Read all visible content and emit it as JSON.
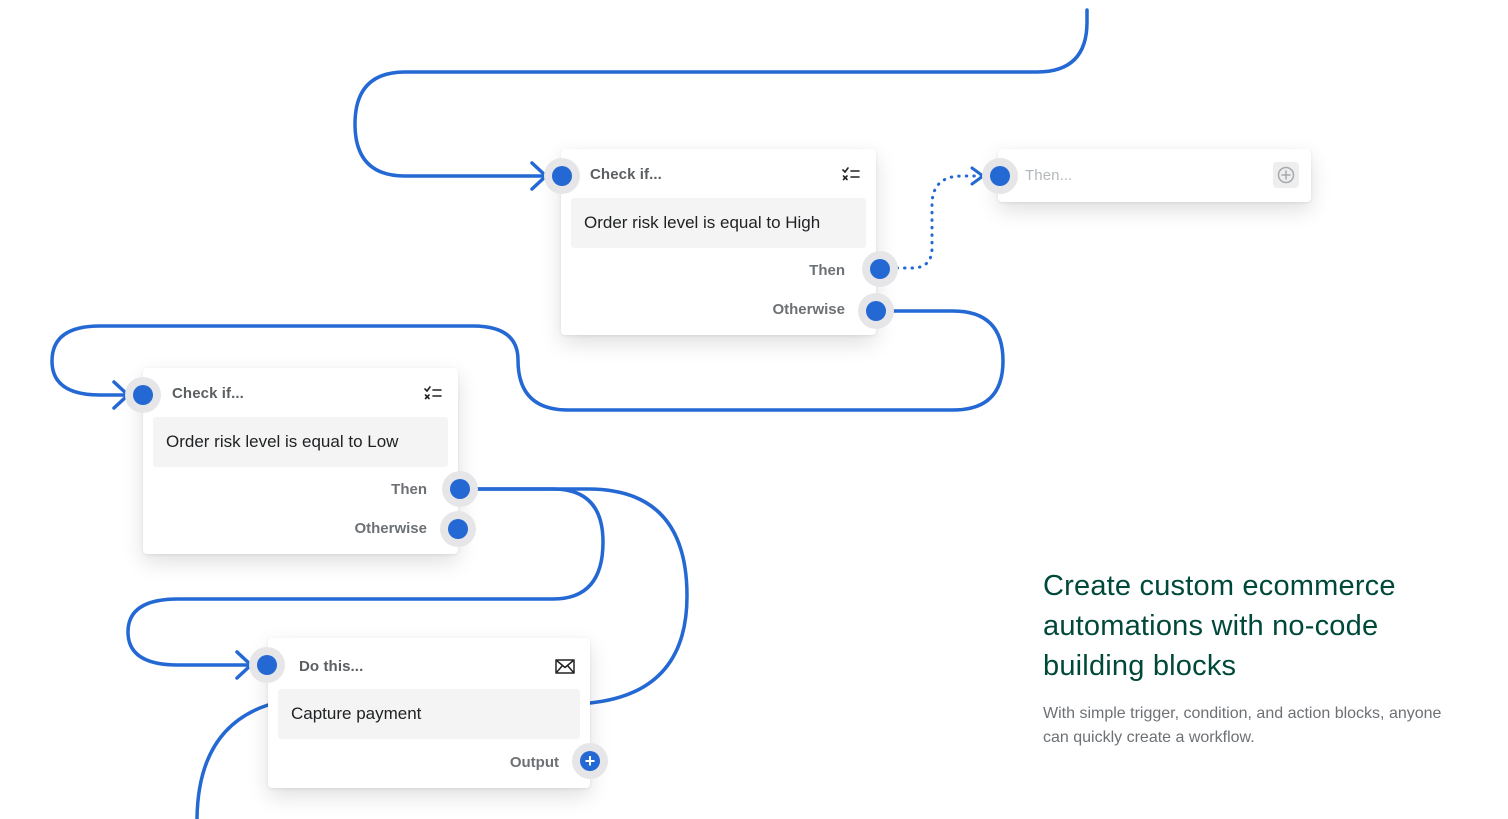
{
  "colors": {
    "connector": "#2468d4",
    "heading_green": "#00493a",
    "muted_text": "#6d7175"
  },
  "blocks": {
    "condition_high": {
      "header": "Check if...",
      "icon": "checklist-icon",
      "body": "Order risk level is equal to High",
      "then_label": "Then",
      "otherwise_label": "Otherwise"
    },
    "then_placeholder": {
      "header": "Then...",
      "icon": "add-circle-icon"
    },
    "condition_low": {
      "header": "Check if...",
      "icon": "checklist-icon",
      "body": "Order risk level is equal to Low",
      "then_label": "Then",
      "otherwise_label": "Otherwise"
    },
    "action": {
      "header": "Do this...",
      "icon": "envelope-icon",
      "body": "Capture payment",
      "output_label": "Output",
      "output_icon": "plus-icon"
    }
  },
  "promo": {
    "title": "Create custom ecommerce automations with no-code building blocks",
    "subtitle": "With simple trigger, condition, and action blocks, anyone can quickly create a workflow."
  }
}
